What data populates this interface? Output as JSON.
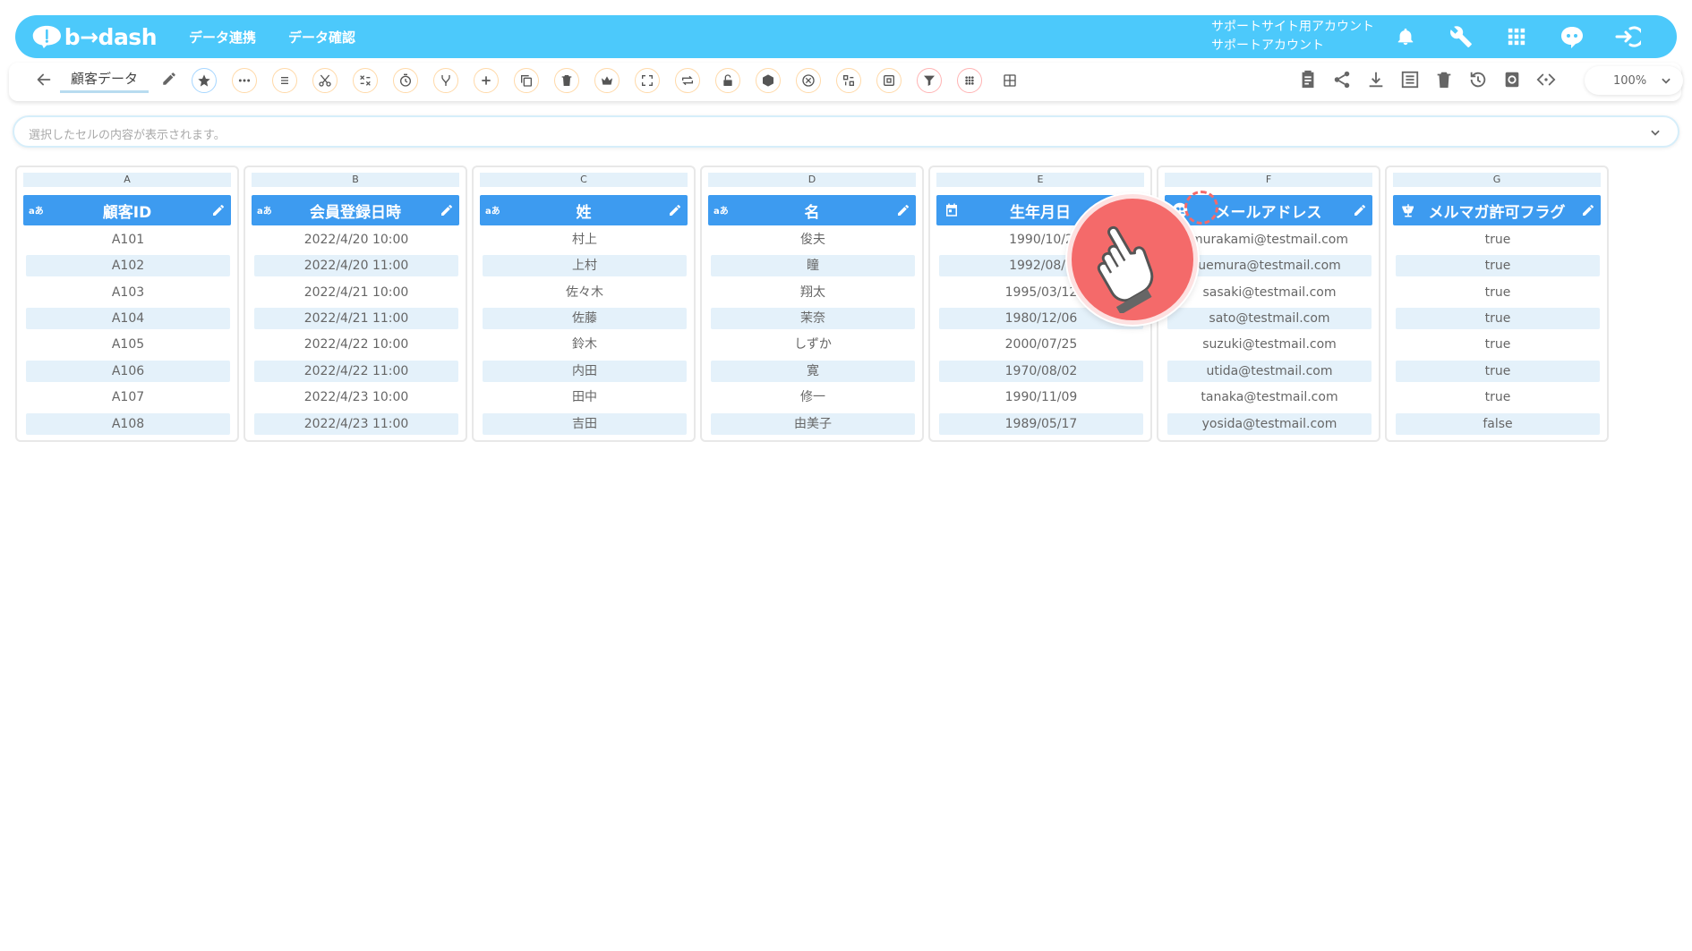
{
  "brand": {
    "logo_text": "b→dash"
  },
  "nav": {
    "link1": "データ連携",
    "link2": "データ確認"
  },
  "account": {
    "line1": "サポートサイト用アカウント",
    "line2": "サポートアカウント"
  },
  "top_icons": [
    "bell-icon",
    "wrench-icon",
    "apps-grid-icon",
    "assistant-icon",
    "logout-icon"
  ],
  "toolbar": {
    "title": "顧客データ",
    "buttons": [
      "star",
      "more",
      "list",
      "cut",
      "no-dup",
      "timer",
      "merge",
      "add",
      "copy",
      "delete",
      "crown",
      "expand",
      "swap",
      "unlock",
      "package",
      "close",
      "transform",
      "frame",
      "filter",
      "grid-dots",
      "table"
    ],
    "right_icons": [
      "clipboard",
      "share",
      "download",
      "list-view",
      "trash",
      "history",
      "refresh",
      "code"
    ],
    "zoom": "100%"
  },
  "cellbar": {
    "placeholder": "選択したセルの内容が表示されます。"
  },
  "colors": {
    "header": "#4cc9fb",
    "column_header": "#3d9bf0",
    "alt_row": "#e4f1fa",
    "pointer": "#f46a6a"
  },
  "columns": [
    {
      "letter": "A",
      "name": "顧客ID",
      "type_label": "aあ",
      "cells": [
        "A101",
        "A102",
        "A103",
        "A104",
        "A105",
        "A106",
        "A107",
        "A108"
      ]
    },
    {
      "letter": "B",
      "name": "会員登録日時",
      "type_label": "aあ",
      "cells": [
        "2022/4/20 10:00",
        "2022/4/20 11:00",
        "2022/4/21 10:00",
        "2022/4/21 11:00",
        "2022/4/22 10:00",
        "2022/4/22 11:00",
        "2022/4/23 10:00",
        "2022/4/23 11:00"
      ]
    },
    {
      "letter": "C",
      "name": "姓",
      "type_label": "aあ",
      "cells": [
        "村上",
        "上村",
        "佐々木",
        "佐藤",
        "鈴木",
        "内田",
        "田中",
        "吉田"
      ]
    },
    {
      "letter": "D",
      "name": "名",
      "type_label": "aあ",
      "cells": [
        "俊夫",
        "瞳",
        "翔太",
        "茉奈",
        "しずか",
        "寛",
        "修一",
        "由美子"
      ]
    },
    {
      "letter": "E",
      "name": "生年月日",
      "type_label": "",
      "cells": [
        "1990/10/2",
        "1992/08/1",
        "1995/03/12",
        "1980/12/06",
        "2000/07/25",
        "1970/08/02",
        "1990/11/09",
        "1989/05/17"
      ]
    },
    {
      "letter": "F",
      "name": "メールアドレス",
      "type_label": "",
      "cells": [
        "murakami@testmail.com",
        "uemura@testmail.com",
        "sasaki@testmail.com",
        "sato@testmail.com",
        "suzuki@testmail.com",
        "utida@testmail.com",
        "tanaka@testmail.com",
        "yosida@testmail.com"
      ]
    },
    {
      "letter": "G",
      "name": "メルマガ許可フラグ",
      "type_label": "",
      "cells": [
        "true",
        "true",
        "true",
        "true",
        "true",
        "true",
        "true",
        "false"
      ]
    }
  ]
}
